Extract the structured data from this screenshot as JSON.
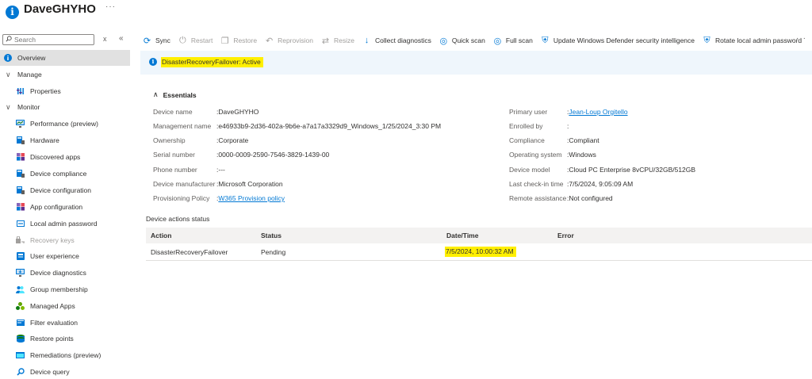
{
  "header": {
    "title": "DaveGHYHO",
    "more": "···"
  },
  "sidebar": {
    "search_placeholder": "Search",
    "clear": "x",
    "collapse": "«",
    "items": [
      {
        "label": "Overview",
        "icon": "info-icon"
      },
      {
        "label": "Manage",
        "icon": "chevron-down-icon"
      },
      {
        "label": "Properties",
        "icon": "properties-icon"
      },
      {
        "label": "Monitor",
        "icon": "chevron-down-icon"
      },
      {
        "label": "Performance (preview)",
        "icon": "performance-icon"
      },
      {
        "label": "Hardware",
        "icon": "hardware-icon"
      },
      {
        "label": "Discovered apps",
        "icon": "apps-icon"
      },
      {
        "label": "Device compliance",
        "icon": "compliance-icon"
      },
      {
        "label": "Device configuration",
        "icon": "configuration-icon"
      },
      {
        "label": "App configuration",
        "icon": "app-configuration-icon"
      },
      {
        "label": "Local admin password",
        "icon": "password-icon"
      },
      {
        "label": "Recovery keys",
        "icon": "key-icon"
      },
      {
        "label": "User experience",
        "icon": "user-experience-icon"
      },
      {
        "label": "Device diagnostics",
        "icon": "diagnostics-icon"
      },
      {
        "label": "Group membership",
        "icon": "group-icon"
      },
      {
        "label": "Managed Apps",
        "icon": "managed-apps-icon"
      },
      {
        "label": "Filter evaluation",
        "icon": "filter-icon"
      },
      {
        "label": "Restore points",
        "icon": "restore-points-icon"
      },
      {
        "label": "Remediations (preview)",
        "icon": "remediations-icon"
      },
      {
        "label": "Device query",
        "icon": "query-icon"
      }
    ]
  },
  "toolbar": {
    "sync": "Sync",
    "restart": "Restart",
    "restore": "Restore",
    "reprovision": "Reprovision",
    "resize": "Resize",
    "collect_diagnostics": "Collect diagnostics",
    "quick_scan": "Quick scan",
    "full_scan": "Full scan",
    "update_defender": "Update Windows Defender security intelligence",
    "rotate_password": "Rotate local admin password",
    "more": "···"
  },
  "banner": {
    "text": "DisasterRecoveryFailover: Active"
  },
  "essentials": {
    "heading": "Essentials",
    "left": [
      {
        "key": "Device name",
        "value": "DaveGHYHO"
      },
      {
        "key": "Management name",
        "value": "e46933b9-2d36-402a-9b6e-a7a17a3329d9_Windows_1/25/2024_3:30 PM"
      },
      {
        "key": "Ownership",
        "value": "Corporate"
      },
      {
        "key": "Serial number",
        "value": "0000-0009-2590-7546-3829-1439-00"
      },
      {
        "key": "Phone number",
        "value": "---"
      },
      {
        "key": "Device manufacturer",
        "value": "Microsoft Corporation"
      },
      {
        "key": "Provisioning Policy",
        "value": "W365 Provision policy"
      }
    ],
    "right": [
      {
        "key": "Primary user",
        "value": "Jean-Loup Orgitello"
      },
      {
        "key": "Enrolled by",
        "value": ""
      },
      {
        "key": "Compliance",
        "value": "Compliant"
      },
      {
        "key": "Operating system",
        "value": "Windows"
      },
      {
        "key": "Device model",
        "value": "Cloud PC Enterprise 8vCPU/32GB/512GB"
      },
      {
        "key": "Last check-in time",
        "value": "7/5/2024, 9:05:09 AM"
      },
      {
        "key": "Remote assistance",
        "value": "Not configured"
      }
    ]
  },
  "actions": {
    "title": "Device actions status",
    "columns": [
      "Action",
      "Status",
      "Date/Time",
      "Error"
    ],
    "rows": [
      {
        "action": "DisasterRecoveryFailover",
        "status": "Pending",
        "datetime": "7/5/2024, 10:00:32 AM",
        "error": ""
      }
    ]
  },
  "colors": {
    "accent": "#0078d4",
    "highlight": "#ffef00",
    "banner_bg": "#eff6fc"
  }
}
